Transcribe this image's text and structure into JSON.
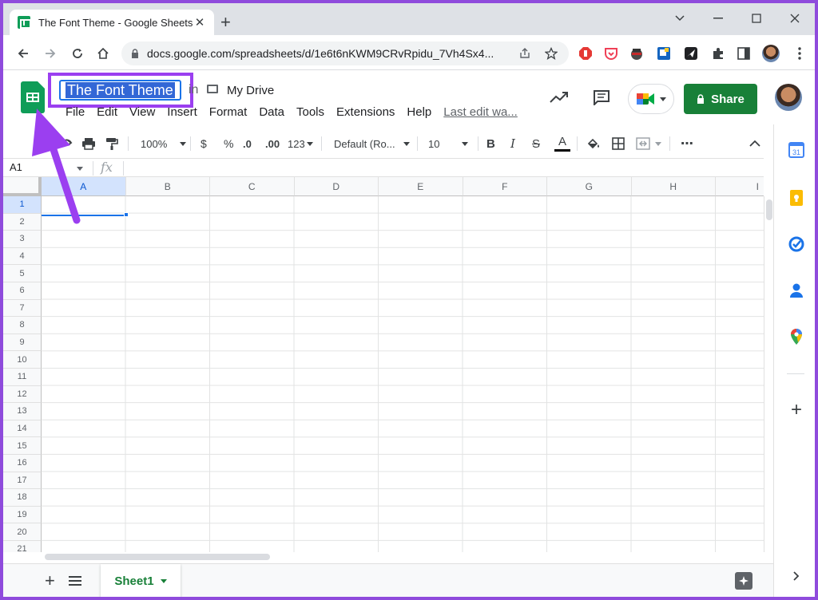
{
  "browser": {
    "tab_title": "The Font Theme - Google Sheets",
    "tab_close": "✕",
    "new_tab": "+",
    "url": "docs.google.com/spreadsheets/d/1e6t6nKWM9CRvRpidu_7Vh4Sx4..."
  },
  "doc": {
    "title": "The Font Theme",
    "in_label": "in",
    "location": "My Drive"
  },
  "menu": {
    "items": [
      "File",
      "Edit",
      "View",
      "Insert",
      "Format",
      "Data",
      "Tools",
      "Extensions",
      "Help"
    ],
    "last_edit": "Last edit wa..."
  },
  "share_label": "Share",
  "format_toolbar": {
    "zoom": "100%",
    "currency": "$",
    "percent": "%",
    "decrease_decimal": ".0",
    "increase_decimal": ".00",
    "more_formats": "123",
    "font": "Default (Ro...",
    "font_size": "10",
    "bold": "B",
    "italic": "I",
    "strikethrough": "S",
    "text_color": "A",
    "more": "⋯"
  },
  "formula_bar": {
    "name_box": "A1",
    "fx": "fx"
  },
  "grid": {
    "columns": [
      "A",
      "B",
      "C",
      "D",
      "E",
      "F",
      "G",
      "H",
      "I"
    ],
    "rows": [
      "1",
      "2",
      "3",
      "4",
      "5",
      "6",
      "7",
      "8",
      "9",
      "10",
      "11",
      "12",
      "13",
      "14",
      "15",
      "16",
      "17",
      "18",
      "19",
      "20",
      "21"
    ],
    "active_cell": "A1"
  },
  "sheets": {
    "add": "+",
    "tabs": [
      "Sheet1"
    ]
  },
  "side_panel": {
    "calendar_day": "31",
    "add": "+"
  },
  "colors": {
    "accent": "#1a73e8",
    "share_green": "#188038",
    "annotation_purple": "#9b3ff0"
  }
}
